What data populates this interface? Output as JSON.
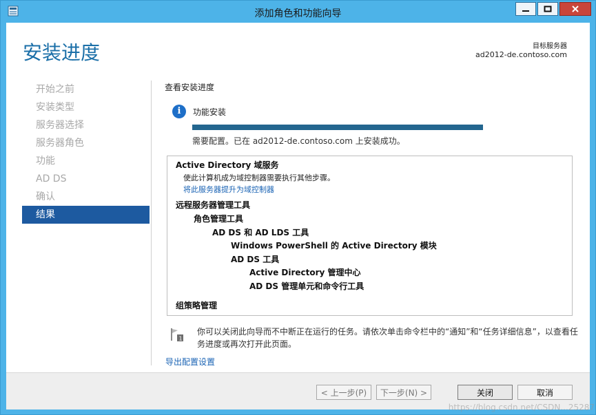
{
  "window": {
    "title": "添加角色和功能向导",
    "min_glyph": "—",
    "max_glyph": "□",
    "close_glyph": "✕"
  },
  "header": {
    "page_title": "安装进度",
    "dest_label": "目标服务器",
    "dest_server": "ad2012-de.contoso.com"
  },
  "nav": {
    "items": [
      {
        "label": "开始之前"
      },
      {
        "label": "安装类型"
      },
      {
        "label": "服务器选择"
      },
      {
        "label": "服务器角色"
      },
      {
        "label": "功能"
      },
      {
        "label": "AD DS"
      },
      {
        "label": "确认"
      },
      {
        "label": "结果"
      }
    ],
    "active_index": 7
  },
  "main": {
    "section_title": "查看安装进度",
    "feature_label": "功能安装",
    "progress": 1.0,
    "status_text": "需要配置。已在 ad2012-de.contoso.com 上安装成功。",
    "results": {
      "adds_title": "Active Directory 域服务",
      "adds_desc": "使此计算机成为域控制器需要执行其他步骤。",
      "promote_link": "将此服务器提升为域控制器",
      "rsat": "远程服务器管理工具",
      "role_tools": "角色管理工具",
      "adds_lds_tools": "AD DS 和 AD LDS 工具",
      "ps_module": "Windows PowerShell 的 Active Directory 模块",
      "adds_tools": "AD DS 工具",
      "ad_admin_center": "Active Directory 管理中心",
      "adds_snapins": "AD DS 管理单元和命令行工具",
      "gpm": "组策略管理"
    },
    "tip_text": "你可以关闭此向导而不中断正在运行的任务。请依次单击命令栏中的“通知”和“任务详细信息”，以查看任务进度或再次打开此页面。",
    "export_link": "导出配置设置"
  },
  "footer": {
    "prev": "< 上一步(P)",
    "next": "下一步(N) >",
    "close": "关闭",
    "cancel": "取消"
  },
  "watermark": "https://blog.csdn.net/CSDN...25287",
  "colors": {
    "accent": "#1b6fa8",
    "nav_active": "#1d5aa0",
    "progress": "#23668f",
    "link": "#1a63b4"
  },
  "icons": {
    "app": "server-manager-icon",
    "info": "info-icon",
    "tip": "flag-icon"
  }
}
